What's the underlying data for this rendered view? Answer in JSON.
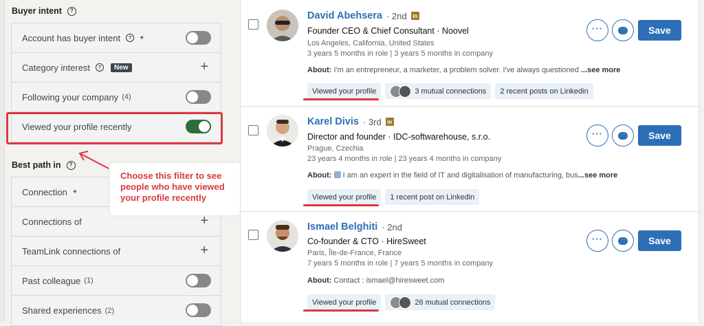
{
  "filters": {
    "buyer_intent_title": "Buyer intent",
    "buyer_intent_rows": [
      {
        "label": "Account has buyer intent",
        "type": "toggle",
        "on": false
      },
      {
        "label": "Category interest",
        "badge": "New",
        "type": "plus"
      },
      {
        "label": "Following your company",
        "count": "(4)",
        "type": "toggle",
        "on": false
      },
      {
        "label": "Viewed your profile recently",
        "type": "toggle",
        "on": true
      }
    ],
    "best_path_title": "Best path in",
    "best_path_rows": [
      {
        "label": "Connection",
        "type": "none"
      },
      {
        "label": "Connections of",
        "type": "plus"
      },
      {
        "label": "TeamLink connections of",
        "type": "plus"
      },
      {
        "label": "Past colleague",
        "count": "(1)",
        "type": "toggle",
        "on": false
      },
      {
        "label": "Shared experiences",
        "count": "(2)",
        "type": "toggle",
        "on": false
      }
    ],
    "plus_symbol": "+",
    "help_symbol": "?",
    "pin_symbol": "✦"
  },
  "annotation": {
    "text": "Choose this filter to see people who have viewed your profile recently",
    "color": "#d9393e"
  },
  "results": [
    {
      "name": "David Abehsera",
      "degree": "· 2nd",
      "headline": "Founder CEO & Chief Consultant · Noovel",
      "location": "Los Angeles, California, United States",
      "tenure": "3 years 5 months in role | 3 years 5 months in company",
      "about_label": "About:",
      "about_text": "I'm an entrepreneur, a marketer, a problem solver. I've always questioned ",
      "see_more": "...see more",
      "chips": [
        "Viewed your profile",
        "3 mutual connections",
        "2 recent posts on Linkedin"
      ],
      "save_label": "Save"
    },
    {
      "name": "Karel Divis",
      "degree": "· 3rd",
      "headline": "Director and founder · IDC-softwarehouse, s.r.o.",
      "location": "Prague, Czechia",
      "tenure": "23 years 4 months in role | 23 years 4 months in company",
      "about_label": "About:",
      "about_text": "I am an expert in the field of IT and digitalisation of manufacturing, bus",
      "see_more": "...see more",
      "chips": [
        "Viewed your profile",
        "1 recent post on Linkedin"
      ],
      "save_label": "Save"
    },
    {
      "name": "Ismael Belghiti",
      "degree": "· 2nd",
      "headline": "Co-founder & CTO · HireSweet",
      "location": "Paris, Île-de-France, France",
      "tenure": "7 years 5 months in role | 7 years 5 months in company",
      "about_label": "About:",
      "about_text": "Contact : ismael@hiresweet.com",
      "see_more": "",
      "chips": [
        "Viewed your profile",
        "26 mutual connections"
      ],
      "save_label": "Save"
    }
  ],
  "icons": {
    "linkedin": "in",
    "more": "···",
    "message": "···"
  },
  "colors": {
    "accent_blue": "#2d6fb7",
    "toggle_on": "#2f6d3b",
    "highlight_red": "#d9393e"
  }
}
